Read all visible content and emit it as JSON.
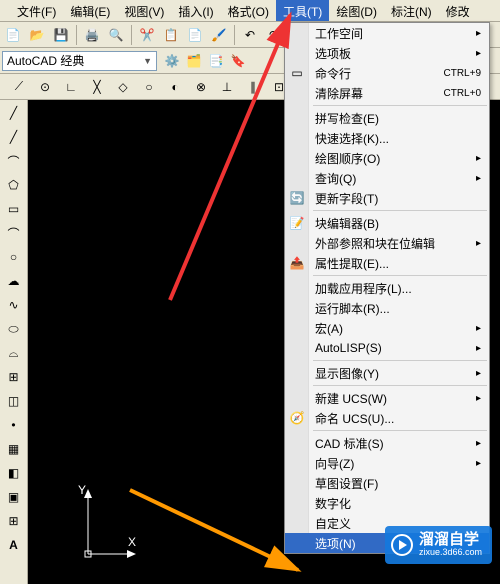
{
  "menubar": {
    "file": "文件(F)",
    "edit": "编辑(E)",
    "view": "视图(V)",
    "insert": "插入(I)",
    "format": "格式(O)",
    "tools": "工具(T)",
    "draw": "绘图(D)",
    "annotate": "标注(N)",
    "modify": "修改"
  },
  "styleCombo": "AutoCAD 经典",
  "dropdown": {
    "workspace": "工作空间",
    "palettes": "选项板",
    "cmdline": "命令行",
    "cmdline_sc": "CTRL+9",
    "clearscreen": "清除屏幕",
    "clearscreen_sc": "CTRL+0",
    "spellcheck": "拼写检查(E)",
    "quickselect": "快速选择(K)...",
    "draworder": "绘图顺序(O)",
    "inquiry": "查询(Q)",
    "updatefields": "更新字段(T)",
    "blockeditor": "块编辑器(B)",
    "xrefedit": "外部参照和块在位编辑",
    "attrextract": "属性提取(E)...",
    "loadapp": "加载应用程序(L)...",
    "runscript": "运行脚本(R)...",
    "macro": "宏(A)",
    "autolisp": "AutoLISP(S)",
    "showimage": "显示图像(Y)",
    "newucs": "新建 UCS(W)",
    "namedocs": "命名 UCS(U)...",
    "cadstd": "CAD 标准(S)",
    "wizard": "向导(Z)",
    "draftsettings": "草图设置(F)",
    "digitize": "数字化",
    "customize": "自定义",
    "options": "选项(N)"
  },
  "ucs": {
    "x": "X",
    "y": "Y"
  },
  "watermark": {
    "title": "溜溜自学",
    "url": "zixue.3d66.com"
  }
}
